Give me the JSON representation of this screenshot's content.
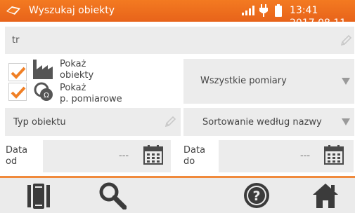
{
  "header": {
    "title": "Wyszukaj obiekty",
    "datetime": "13:41 2017.08.11",
    "icons": [
      "app-logo-icon",
      "signal-icon",
      "plug-icon",
      "battery-icon"
    ]
  },
  "search": {
    "value": "tr"
  },
  "options": {
    "show_objects_line1": "Pokaż",
    "show_objects_line2": "obiekty",
    "show_points_line1": "Pokaż",
    "show_points_line2": "p. pomiarowe",
    "show_objects_checked": true,
    "show_points_checked": true
  },
  "measurements_dropdown": {
    "value": "Wszystkie pomiary"
  },
  "object_type": {
    "placeholder": "Typ obiektu"
  },
  "sort_dropdown": {
    "value": "Sortowanie według nazwy"
  },
  "date_from": {
    "label_line1": "Data",
    "label_line2": "od",
    "value": "---"
  },
  "date_to": {
    "label_line1": "Data",
    "label_line2": "do",
    "value": "---"
  },
  "footer": {
    "buttons": [
      "objects-tree-icon",
      "search-icon",
      "help-icon",
      "home-icon"
    ]
  },
  "colors": {
    "accent": "#f37a21",
    "check": "#f07f25",
    "field": "#ececec",
    "icon_dark": "#3b3b3b"
  }
}
